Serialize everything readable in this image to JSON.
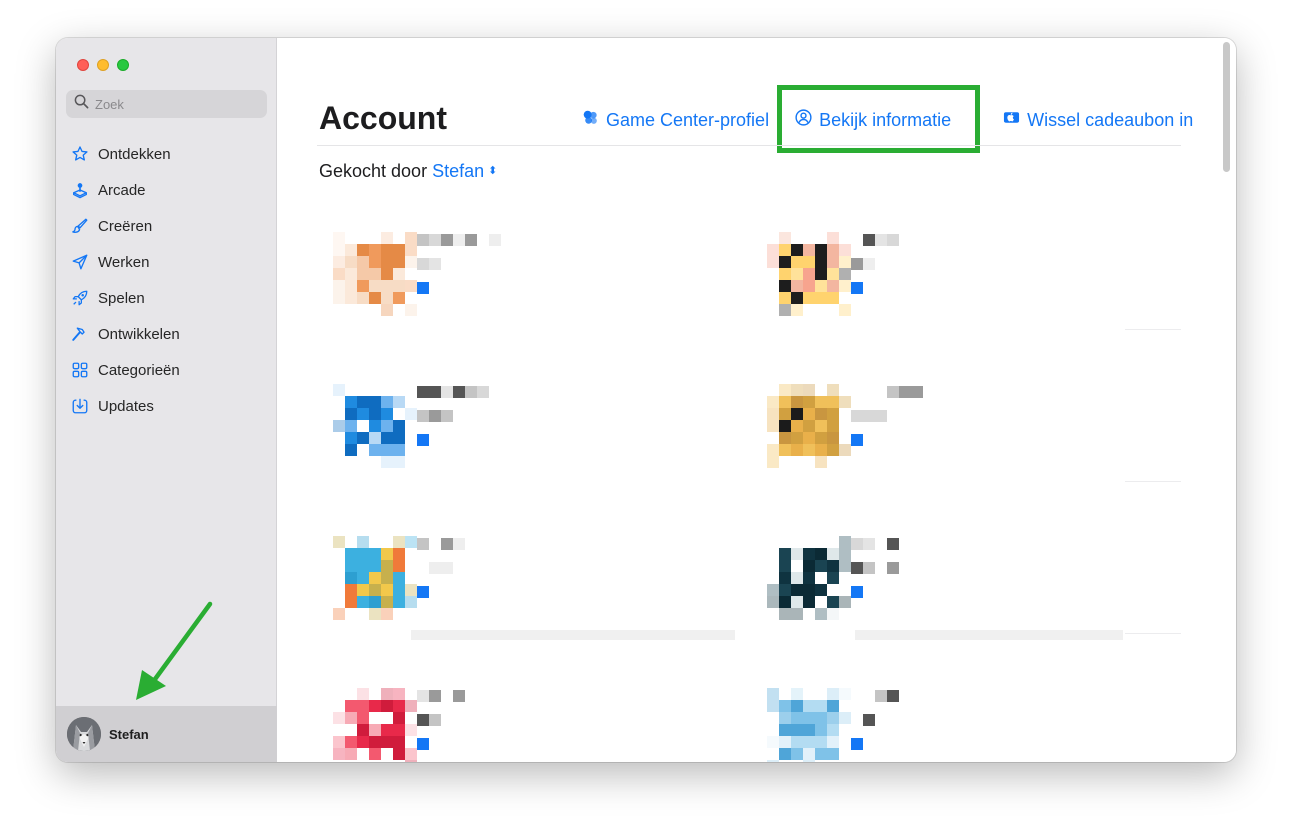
{
  "window": {
    "colors": {
      "accent": "#1477f5",
      "highlight": "#2aad33",
      "close": "#ff5f57",
      "minimize": "#febc2e",
      "zoom": "#28c840"
    }
  },
  "sidebar": {
    "search": {
      "placeholder": "Zoek",
      "icon": "search-icon"
    },
    "items": [
      {
        "label": "Ontdekken",
        "icon": "star-icon"
      },
      {
        "label": "Arcade",
        "icon": "joystick-icon"
      },
      {
        "label": "Creëren",
        "icon": "brush-icon"
      },
      {
        "label": "Werken",
        "icon": "paper-plane-icon"
      },
      {
        "label": "Spelen",
        "icon": "rocket-icon"
      },
      {
        "label": "Ontwikkelen",
        "icon": "hammer-icon"
      },
      {
        "label": "Categorieën",
        "icon": "grid-icon"
      },
      {
        "label": "Updates",
        "icon": "download-icon"
      }
    ],
    "profile": {
      "name": "Stefan",
      "avatar": "wolf-avatar"
    }
  },
  "main": {
    "title": "Account",
    "links": {
      "game_center": "Game Center-profiel",
      "view_info": "Bekijk informatie",
      "redeem_gift": "Wissel cadeaubon in"
    },
    "purchased_by": {
      "label": "Gekocht door",
      "name": "Stefan"
    },
    "apps": [
      {
        "icon": "blurred-app-icon"
      },
      {
        "icon": "blurred-app-icon"
      },
      {
        "icon": "blurred-app-icon"
      },
      {
        "icon": "blurred-app-icon"
      },
      {
        "icon": "blurred-app-icon"
      },
      {
        "icon": "blurred-app-icon"
      },
      {
        "icon": "blurred-app-icon"
      },
      {
        "icon": "blurred-app-icon"
      }
    ]
  }
}
